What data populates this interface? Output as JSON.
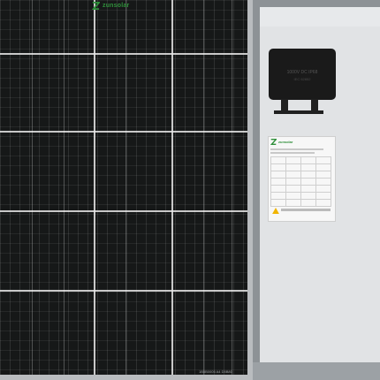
{
  "front": {
    "brand_name": "zunsolar",
    "brand_sticker": "1B5B0005 A4 D5B80"
  },
  "back": {
    "junction_box": {
      "text": "1000V DC IP68",
      "sub": "IEC 62852"
    },
    "label": {
      "brand_name": "zunsolar"
    }
  },
  "colors": {
    "brand_green": "#2f8f3a",
    "cell_black": "#161818",
    "frame_gray": "#b9bcbf",
    "back_sheet": "#e1e3e5"
  }
}
